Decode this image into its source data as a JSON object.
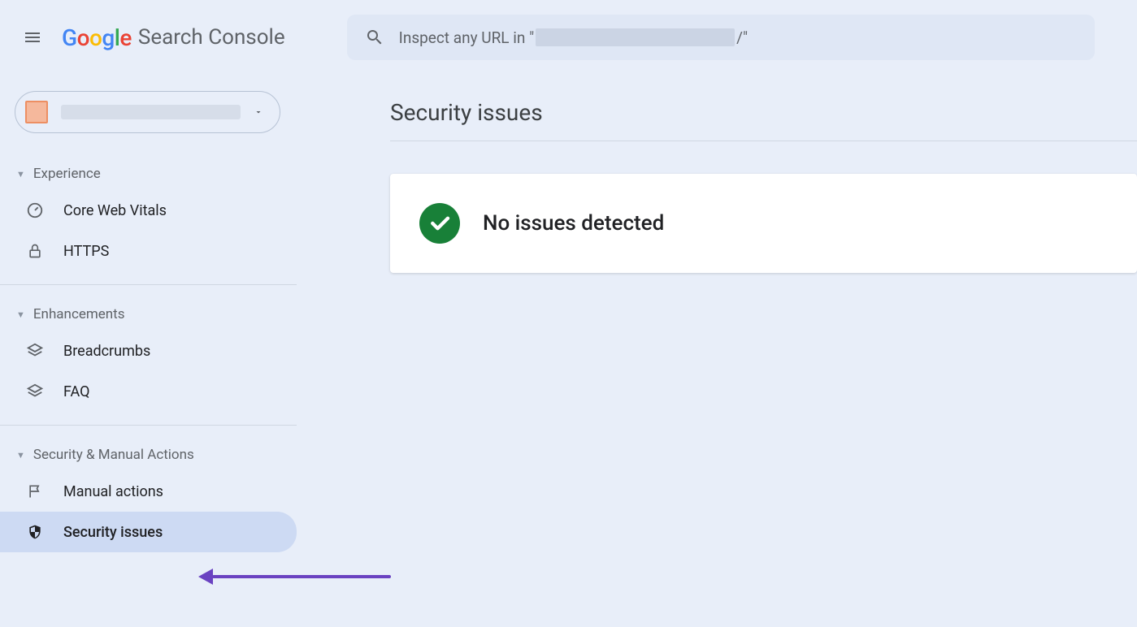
{
  "header": {
    "product_name": "Search Console",
    "search_prefix": "Inspect any URL in \"",
    "search_suffix": "/\""
  },
  "sidebar": {
    "sections": [
      {
        "title": "Experience",
        "items": [
          {
            "label": "Core Web Vitals"
          },
          {
            "label": "HTTPS"
          }
        ]
      },
      {
        "title": "Enhancements",
        "items": [
          {
            "label": "Breadcrumbs"
          },
          {
            "label": "FAQ"
          }
        ]
      },
      {
        "title": "Security & Manual Actions",
        "items": [
          {
            "label": "Manual actions"
          },
          {
            "label": "Security issues"
          }
        ]
      }
    ]
  },
  "main": {
    "page_title": "Security issues",
    "status_message": "No issues detected"
  }
}
